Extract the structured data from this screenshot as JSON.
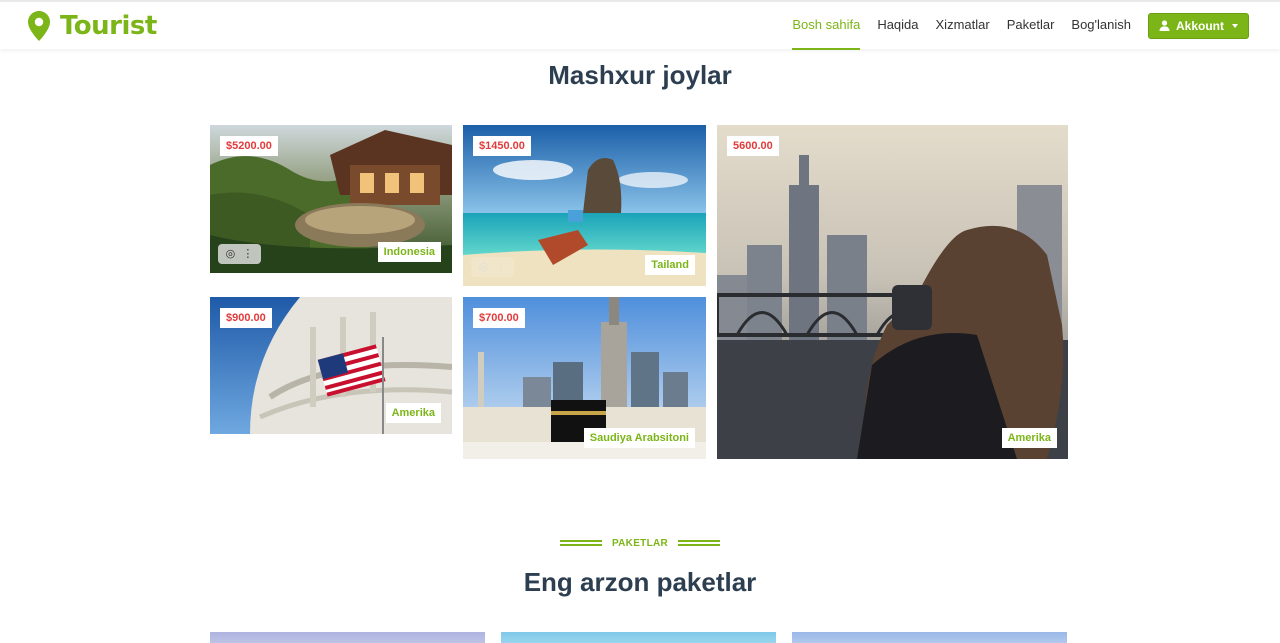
{
  "brand": {
    "name": "Tourist",
    "icon": "map-pin-icon",
    "color": "#7cb518"
  },
  "nav": {
    "items": [
      {
        "label": "Bosh sahifa",
        "active": true
      },
      {
        "label": "Haqida",
        "active": false
      },
      {
        "label": "Xizmatlar",
        "active": false
      },
      {
        "label": "Paketlar",
        "active": false
      },
      {
        "label": "Bog'lanish",
        "active": false
      }
    ],
    "account_label": "Akkount",
    "account_icon": "user-icon"
  },
  "popular": {
    "title": "Mashxur joylar",
    "tiles": [
      {
        "price": "$5200.00",
        "country": "Indonesia"
      },
      {
        "price": "$1450.00",
        "country": "Tailand"
      },
      {
        "price": "5600.00",
        "country": "Amerika"
      },
      {
        "price": "$900.00",
        "country": "Amerika"
      },
      {
        "price": "$700.00",
        "country": "Saudiya Arabsitoni"
      }
    ]
  },
  "packages": {
    "eyebrow": "PAKETLAR",
    "title": "Eng arzon paketlar"
  },
  "colors": {
    "accent": "#7cb518",
    "price": "#e23b3b",
    "heading": "#2c3e50"
  }
}
